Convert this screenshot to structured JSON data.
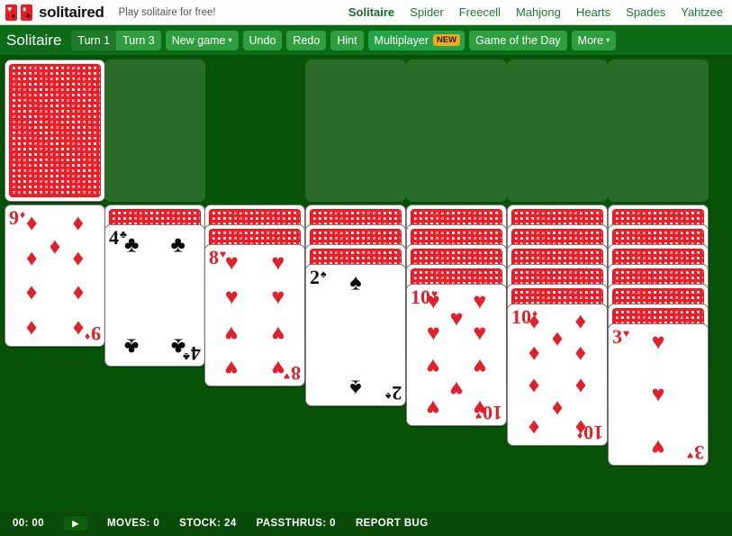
{
  "site": {
    "logo_text": "solitaired",
    "logo_cards": [
      {
        "top_suit": "♥",
        "bottom_suit": "♠"
      },
      {
        "top_suit": "♦",
        "bottom_suit": "♣"
      }
    ],
    "tagline": "Play solitaire for free!",
    "nav": [
      {
        "label": "Solitaire",
        "active": true
      },
      {
        "label": "Spider",
        "active": false
      },
      {
        "label": "Freecell",
        "active": false
      },
      {
        "label": "Mahjong",
        "active": false
      },
      {
        "label": "Hearts",
        "active": false
      },
      {
        "label": "Spades",
        "active": false
      },
      {
        "label": "Yahtzee",
        "active": false
      }
    ]
  },
  "toolbar": {
    "game_title": "Solitaire",
    "turn1_label": "Turn 1",
    "turn3_label": "Turn 3",
    "new_game_label": "New game",
    "undo_label": "Undo",
    "redo_label": "Redo",
    "hint_label": "Hint",
    "multiplayer_label": "Multiplayer",
    "multiplayer_badge": "NEW",
    "game_of_the_day_label": "Game of the Day",
    "more_label": "More",
    "caret": "▾"
  },
  "colors": {
    "board_green": "#065206",
    "slot_green": "#2a6b28",
    "toolbar_green": "#0b6b16",
    "button_green": "#2e9e3e",
    "button_green_dark": "#1f7a2b",
    "multiplayer_green": "#23a447",
    "badge_orange": "#f5a81c",
    "card_red": "#e3202a",
    "card_black": "#0b0b0b",
    "status_green": "#0a4b0a",
    "nav_link_green": "#1a7a34"
  },
  "board": {
    "stock": {
      "face_down_count": 1,
      "has_card": true
    },
    "waste_empty": true,
    "foundations": [
      {
        "suit": null,
        "empty": true
      },
      {
        "suit": null,
        "empty": true
      },
      {
        "suit": null,
        "empty": true
      },
      {
        "suit": null,
        "empty": true
      }
    ],
    "tableau": [
      {
        "index": 1,
        "face_down": 0,
        "face_up": [
          {
            "rank": "9",
            "suit": "♦",
            "color": "red"
          }
        ]
      },
      {
        "index": 2,
        "face_down": 1,
        "face_up": [
          {
            "rank": "4",
            "suit": "♣",
            "color": "black"
          }
        ]
      },
      {
        "index": 3,
        "face_down": 2,
        "face_up": [
          {
            "rank": "8",
            "suit": "♥",
            "color": "red"
          }
        ]
      },
      {
        "index": 4,
        "face_down": 3,
        "face_up": [
          {
            "rank": "2",
            "suit": "♠",
            "color": "black"
          }
        ]
      },
      {
        "index": 5,
        "face_down": 4,
        "face_up": [
          {
            "rank": "10",
            "suit": "♥",
            "color": "red"
          }
        ]
      },
      {
        "index": 6,
        "face_down": 5,
        "face_up": [
          {
            "rank": "10",
            "suit": "♦",
            "color": "red"
          }
        ]
      },
      {
        "index": 7,
        "face_down": 6,
        "face_up": [
          {
            "rank": "3",
            "suit": "♥",
            "color": "red"
          }
        ]
      }
    ]
  },
  "status": {
    "timer": "00: 00",
    "play_icon": "▶",
    "moves_label": "MOVES: 0",
    "stock_label": "STOCK: 24",
    "passthrus_label": "PASSTHRUS: 0",
    "report_bug_label": "REPORT BUG"
  }
}
